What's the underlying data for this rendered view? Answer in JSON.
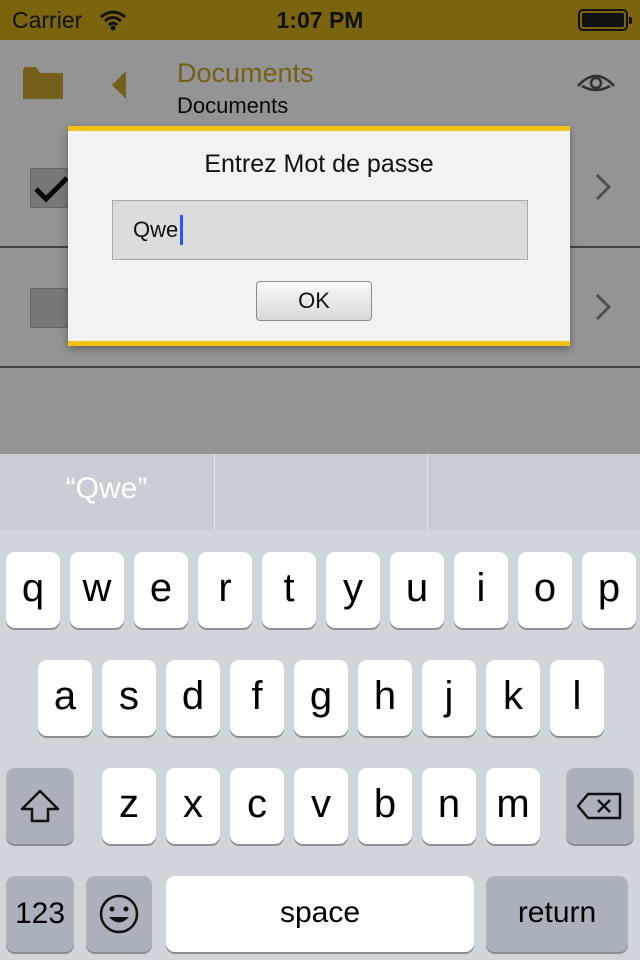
{
  "status_bar": {
    "carrier": "Carrier",
    "time": "1:07 PM",
    "battery_level": 1.0
  },
  "app": {
    "nav_title": "Documents",
    "nav_subtitle": "Documents",
    "icons": [
      "folder-icon",
      "back-icon",
      "eye-icon",
      "checkmark-icon",
      "chevron-right-icon"
    ]
  },
  "dialog": {
    "title": "Entrez Mot de passe",
    "field_value": "Qwe",
    "ok_label": "OK",
    "accent_color": "#f3c014"
  },
  "keyboard": {
    "suggestions": [
      "“Qwe”",
      "",
      ""
    ],
    "row1": [
      "q",
      "w",
      "e",
      "r",
      "t",
      "y",
      "u",
      "i",
      "o",
      "p"
    ],
    "row2": [
      "a",
      "s",
      "d",
      "f",
      "g",
      "h",
      "j",
      "k",
      "l"
    ],
    "row3": [
      "z",
      "x",
      "c",
      "v",
      "b",
      "n",
      "m"
    ],
    "numbers_label": "123",
    "space_label": "space",
    "return_label": "return"
  }
}
